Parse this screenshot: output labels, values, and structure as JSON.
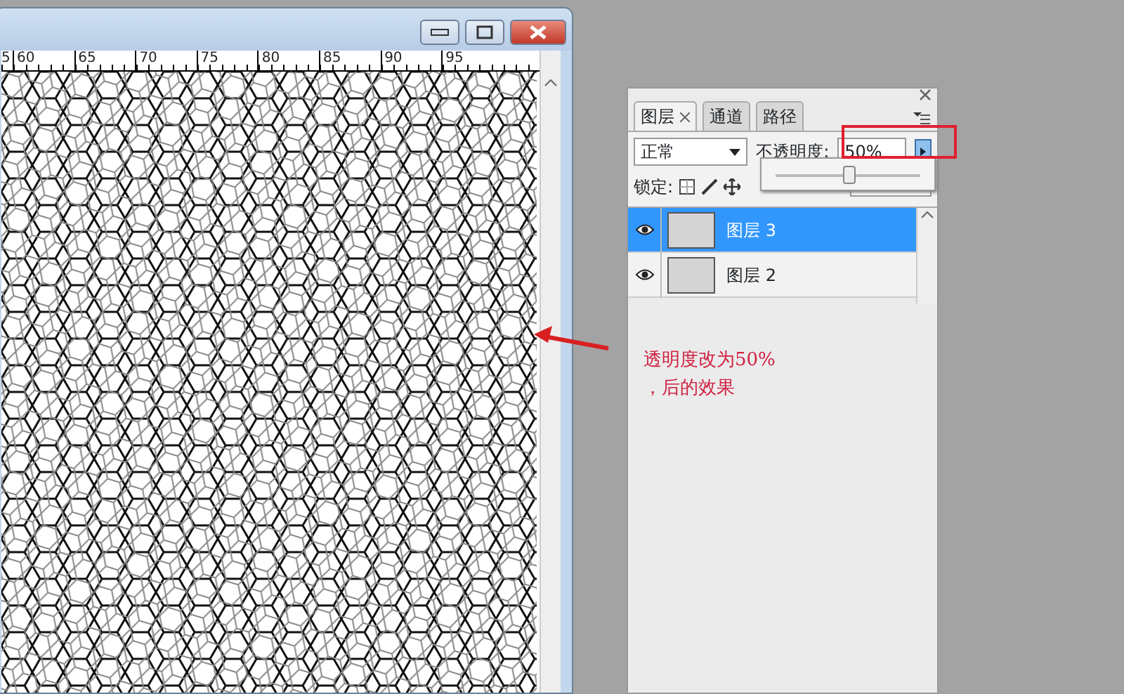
{
  "document_window": {
    "ruler_labels": [
      "5",
      "60",
      "65",
      "70",
      "75",
      "80",
      "85",
      "90",
      "95"
    ]
  },
  "layers_panel": {
    "tabs": [
      {
        "label": "图层",
        "selected": true,
        "closable": true
      },
      {
        "label": "通道",
        "selected": false,
        "closable": false
      },
      {
        "label": "路径",
        "selected": false,
        "closable": false
      }
    ],
    "blend_mode": "正常",
    "opacity_label": "不透明度:",
    "opacity_value": "50%",
    "opacity_slider": {
      "level": 0.5
    },
    "lock_label": "锁定:",
    "layers": [
      {
        "name": "图层 3",
        "selected": true,
        "visible": true
      },
      {
        "name": "图层 2",
        "selected": false,
        "visible": true
      }
    ]
  },
  "annotation": {
    "lines": [
      "透明度改为50%",
      "，后的效果"
    ]
  }
}
